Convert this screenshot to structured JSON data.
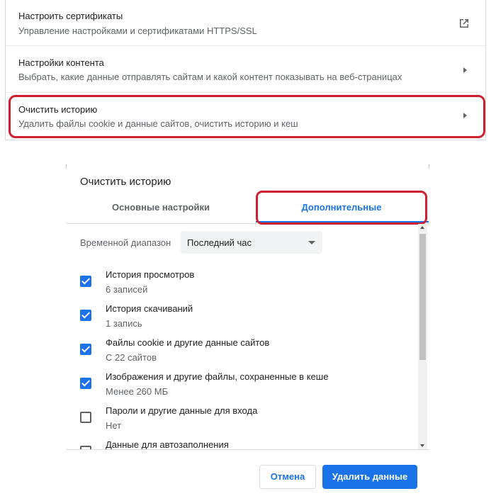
{
  "settings": {
    "rows": [
      {
        "title": "Настроить сертификаты",
        "subtitle": "Управление настройками и сертификатами HTTPS/SSL",
        "icon": "external-link-icon"
      },
      {
        "title": "Настройки контента",
        "subtitle": "Выбрать, какие данные отправлять сайтам и какой контент показывать на веб-страницах",
        "icon": "chevron-right-icon"
      },
      {
        "title": "Очистить историю",
        "subtitle": "Удалить файлы cookie и данные сайтов, очистить историю и кеш",
        "icon": "chevron-right-icon"
      }
    ]
  },
  "dialog": {
    "title": "Очистить историю",
    "tabs": [
      {
        "label": "Основные настройки",
        "active": false
      },
      {
        "label": "Дополнительные",
        "active": true
      }
    ],
    "time_range": {
      "label": "Временной диапазон",
      "value": "Последний час"
    },
    "items": [
      {
        "title": "История просмотров",
        "subtitle": "6 записей",
        "checked": true
      },
      {
        "title": "История скачиваний",
        "subtitle": "1 запись",
        "checked": true
      },
      {
        "title": "Файлы cookie и другие данные сайтов",
        "subtitle": "С 22 сайтов",
        "checked": true
      },
      {
        "title": "Изображения и другие файлы, сохраненные в кеше",
        "subtitle": "Менее 260 МБ",
        "checked": true
      },
      {
        "title": "Пароли и другие данные для входа",
        "subtitle": "Нет",
        "checked": false
      },
      {
        "title": "Данные для автозаполнения",
        "subtitle": "",
        "checked": false
      }
    ],
    "buttons": {
      "cancel": "Отмена",
      "delete": "Удалить данные"
    }
  },
  "colors": {
    "accent": "#1a73e8",
    "highlight": "#d0202f"
  }
}
